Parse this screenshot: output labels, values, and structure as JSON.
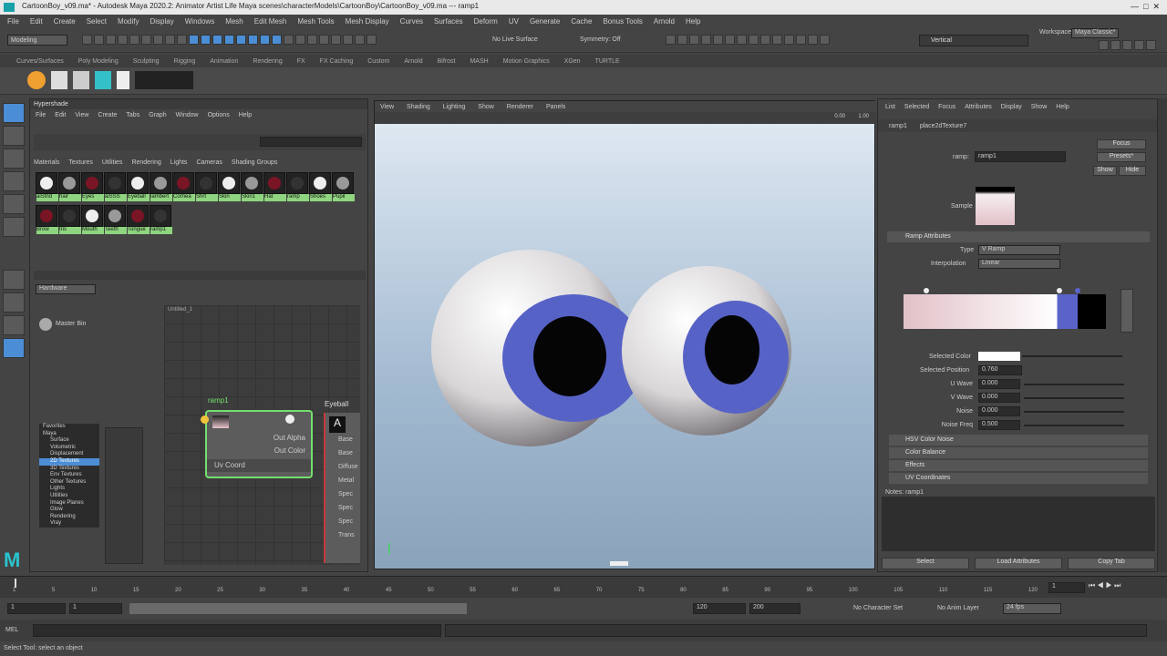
{
  "window": {
    "title": "CartoonBoy_v09.ma* - Autodesk Maya 2020.2: Animator Artist Life Maya scenes\\characterModels\\CartoonBoy\\CartoonBoy_v09.ma --- ramp1"
  },
  "main_menu": [
    "File",
    "Edit",
    "Create",
    "Select",
    "Modify",
    "Display",
    "Windows",
    "Mesh",
    "Edit Mesh",
    "Mesh Tools",
    "Mesh Display",
    "Curves",
    "Surfaces",
    "Deform",
    "UV",
    "Generate",
    "Cache",
    "Bonus Tools",
    "Arnold",
    "Help"
  ],
  "status": {
    "mode": "Modeling",
    "workspace_label": "Workspace:",
    "workspace": "Maya Classic*",
    "live_surface": "No Live Surface",
    "symmetry": "Symmetry: Off",
    "search_text": "Vertical"
  },
  "shelf_tabs": [
    "Curves/Surfaces",
    "Poly Modeling",
    "Sculpting",
    "Rigging",
    "Animation",
    "Rendering",
    "FX",
    "FX Caching",
    "Custom",
    "Arnold",
    "Bifrost",
    "MASH",
    "Motion Graphics",
    "XGen",
    "TURTLE"
  ],
  "hypershade": {
    "title": "Hypershade",
    "menus": [
      "File",
      "Edit",
      "View",
      "Create",
      "Tabs",
      "Graph",
      "Window",
      "Options",
      "Help"
    ],
    "browser_tabs": [
      "Materials",
      "Textures",
      "Utilities",
      "Rendering",
      "Lights",
      "Cameras",
      "Shading Groups"
    ],
    "materials": [
      "aiStnd",
      "hair",
      "Eyes",
      "aiSSS",
      "Eyeball",
      "lambert",
      "Cornea",
      "Shrt",
      "Skin",
      "Skin1",
      "Hat",
      "ramp",
      "Shoes",
      "Pupil",
      "Brow",
      "Iris",
      "Mouth",
      "Teeth",
      "Tongue",
      "ramp1"
    ],
    "create_menu": "Hardware",
    "bar_item": "Master Bin",
    "tree": [
      "Favorites",
      "Maya",
      "Surface",
      "Volumetric",
      "Displacement",
      "2D Textures",
      "3D Textures",
      "Env Textures",
      "Other Textures",
      "Lights",
      "Utilities",
      "Image Planes",
      "Glow",
      "Rendering",
      "Vray"
    ],
    "graph_tab": "Untitled_1",
    "ramp_node": {
      "name": "ramp1",
      "ports": [
        "Out Alpha",
        "Out Color"
      ],
      "input": "Uv Coord"
    },
    "eyeball_node": {
      "name": "Eyeball",
      "ports": [
        "Base",
        "Base",
        "Diffuse",
        "Metal",
        "Spec",
        "Spec",
        "Spec",
        "Trans"
      ]
    }
  },
  "viewport": {
    "menus": [
      "View",
      "Shading",
      "Lighting",
      "Show",
      "Renderer",
      "Panels"
    ],
    "exposure": "0.00",
    "gamma": "1.00"
  },
  "attribute_editor": {
    "menus": [
      "List",
      "Selected",
      "Focus",
      "Attributes",
      "Display",
      "Show",
      "Help"
    ],
    "tabs": [
      "ramp1",
      "place2dTexture7"
    ],
    "ramp_label": "ramp:",
    "ramp_value": "ramp1",
    "buttons": [
      "Focus",
      "Presets*",
      "Show",
      "Hide"
    ],
    "sample_label": "Sample",
    "section_ramp": "Ramp Attributes",
    "type_label": "Type",
    "type_value": "V Ramp",
    "interp_label": "Interpolation",
    "interp_value": "Linear",
    "selected_color": "Selected Color",
    "selected_position": "Selected Position",
    "selected_position_value": "0.760",
    "attrs": [
      {
        "label": "U Wave",
        "value": "0.000"
      },
      {
        "label": "V Wave",
        "value": "0.000"
      },
      {
        "label": "Noise",
        "value": "0.000"
      },
      {
        "label": "Noise Freq",
        "value": "0.500"
      }
    ],
    "sections": [
      "HSV Color Noise",
      "Color Balance",
      "Effects",
      "UV Coordinates"
    ],
    "notes_label": "Notes: ramp1",
    "bottom_buttons": [
      "Select",
      "Load Attributes",
      "Copy Tab"
    ],
    "colors": {
      "ramp_left": "#e2c1c8",
      "ramp_mid": "#ffffff",
      "iris": "#5a64c8",
      "pupil": "#000000"
    }
  },
  "time": {
    "ticks": [
      "1",
      "5",
      "10",
      "15",
      "20",
      "25",
      "30",
      "35",
      "40",
      "45",
      "50",
      "55",
      "60",
      "65",
      "70",
      "75",
      "80",
      "85",
      "90",
      "95",
      "100",
      "105",
      "110",
      "115",
      "120"
    ],
    "current": "1",
    "start": "1",
    "range_start": "1",
    "range_end": "120",
    "end": "120",
    "total": "200",
    "character_set": "No Character Set",
    "anim_layer": "No Anim Layer",
    "fps": "24 fps"
  },
  "command_line": {
    "label": "MEL"
  },
  "help_line": "Select Tool: select an object"
}
